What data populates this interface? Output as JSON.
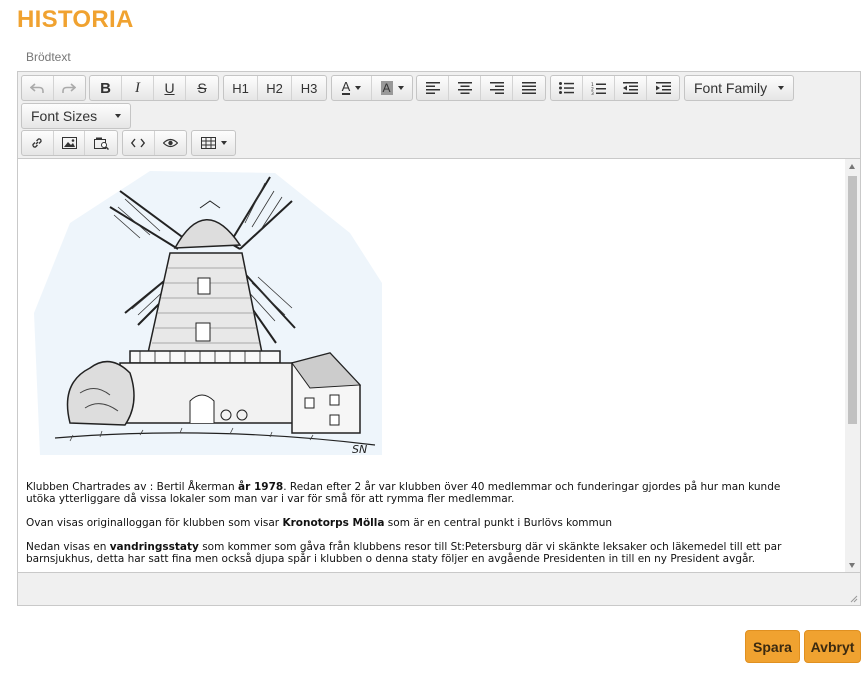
{
  "page": {
    "title": "HISTORIA",
    "field_label": "Brödtext"
  },
  "toolbar": {
    "h1": "H1",
    "h2": "H2",
    "h3": "H3",
    "bold": "B",
    "italic": "I",
    "underline": "U",
    "strike": "S",
    "font_family": "Font Family",
    "font_sizes": "Font Sizes"
  },
  "content": {
    "image_icon_name": "windmill-sketch",
    "p1_a": "Klubben Chartrades av : Bertil Åkerman ",
    "p1_b": "år 1978",
    "p1_c": ". Redan efter 2 år var klubben över 40 medlemmar och funderingar gjordes på hur man kunde",
    "p1_d": "utöka ytterliggare då vissa lokaler som man var i var för små för att rymma fler medlemmar.",
    "p2_a": "Ovan visas originalloggan för klubben som visar ",
    "p2_b": "Kronotorps Mölla",
    "p2_c": " som är en central punkt i Burlövs kommun",
    "p3_a": "Nedan visas en ",
    "p3_b": "vandringsstaty",
    "p3_c": " som kommer som gåva från klubbens resor till St:Petersburg där vi skänkte leksaker och läkemedel till ett par",
    "p3_d": "barnsjukhus, detta har satt fina men också djupa spår i klubben o denna staty följer en avgående Presidenten in till en ny President avgår."
  },
  "actions": {
    "save": "Spara",
    "cancel": "Avbryt"
  },
  "colors": {
    "accent": "#f0a230"
  }
}
